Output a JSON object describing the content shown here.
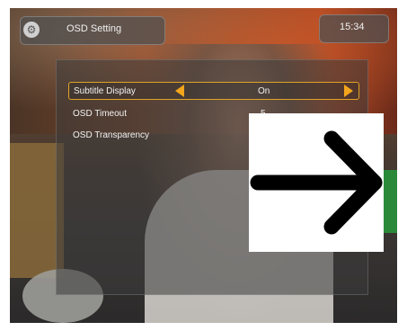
{
  "window": {
    "title": "OSD Setting",
    "clock": "15:34"
  },
  "menu": {
    "items": [
      {
        "label": "Subtitle Display",
        "value": "On",
        "selected": true
      },
      {
        "label": "OSD Timeout",
        "value": "5",
        "selected": false
      },
      {
        "label": "OSD Transparency",
        "value": "",
        "selected": false
      }
    ]
  },
  "overlay": {
    "icon": "right-arrow-icon"
  },
  "colors": {
    "accent": "#f3a51c",
    "panel": "#3c3c3c"
  }
}
